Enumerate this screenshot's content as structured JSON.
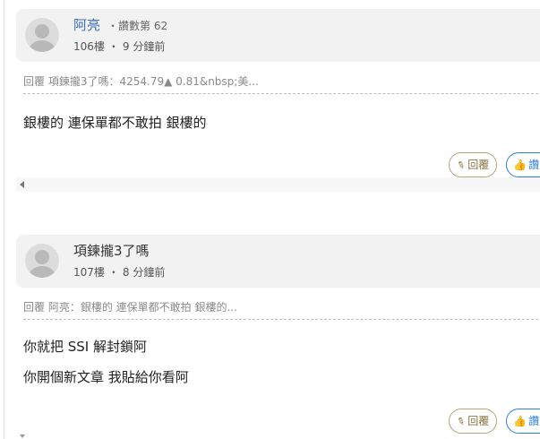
{
  "posts": [
    {
      "author": "阿亮",
      "rank": "・讚數第 62",
      "floor": "106樓",
      "time": "9 分鐘前",
      "reply_quote": "回覆 項鍊攏3了嗎：4254.79▲ 0.81&nbsp;美...",
      "content": [
        "銀樓的 連保單都不敢拍 銀樓的"
      ],
      "actions": {
        "reply": "回覆",
        "like": "讚"
      }
    },
    {
      "author": "項鍊攏3了嗎",
      "rank": "",
      "floor": "107樓",
      "time": "8 分鐘前",
      "reply_quote": "回覆 阿亮：銀樓的 連保單都不敢拍 銀樓的...",
      "content": [
        "你就把 SSI 解封鎖阿",
        "你開個新文章 我貼給你看阿"
      ],
      "actions": {
        "reply": "回覆",
        "like": "讚"
      }
    }
  ],
  "meta_separator": "・",
  "icons": {
    "reply": "pencil-icon",
    "like": "thumbs-up-icon",
    "scroll_left": "scroll-left-arrow-icon"
  },
  "colors": {
    "author_link": "#3f6fb7",
    "reply_button": "#8a7440",
    "like_button": "#2d7fd6"
  }
}
